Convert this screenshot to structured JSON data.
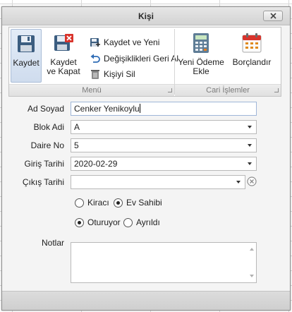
{
  "window": {
    "title": "Kişi",
    "close_symbol": "✕"
  },
  "ribbon": {
    "groups": [
      {
        "label": "Menü"
      },
      {
        "label": "Cari İşlemler"
      }
    ],
    "kaydet": "Kaydet",
    "kaydet_kapat_1": "Kaydet",
    "kaydet_kapat_2": "ve Kapat",
    "kaydet_yeni": "Kaydet ve Yeni",
    "geri_al": "Değişiklikleri Geri Al",
    "sil": "Kişiyi Sil",
    "yeni_odeme_1": "Yeni Ödeme",
    "yeni_odeme_2": "Ekle",
    "borclandir": "Borçlandır",
    "icons": [
      "floppy-disk-icon",
      "floppy-disk-close-icon",
      "save-and-new-icon",
      "undo-icon",
      "trash-icon",
      "calculator-icon",
      "calendar-icon",
      "group-launcher-icon"
    ]
  },
  "form": {
    "ad_soyad": {
      "label": "Ad Soyad",
      "value": "Cenker Yenikoylu"
    },
    "blok_adi": {
      "label": "Blok Adi",
      "value": "A"
    },
    "daire_no": {
      "label": "Daire No",
      "value": "5"
    },
    "giris_tarihi": {
      "label": "Giriş Tarihi",
      "value": "2020-02-29"
    },
    "cikis_tarihi": {
      "label": "Çıkış Tarihi",
      "value": ""
    },
    "sakin_tipi": {
      "options": [
        "Kiracı",
        "Ev Sahibi"
      ],
      "selected": "Ev Sahibi"
    },
    "durum": {
      "options": [
        "Oturuyor",
        "Ayrıldı"
      ],
      "selected": "Oturuyor"
    },
    "notlar": {
      "label": "Notlar",
      "value": ""
    }
  },
  "colors": {
    "accent": "#cfdcee",
    "window_bg": "#f4f4f4",
    "delete_red": "#d9332b"
  }
}
